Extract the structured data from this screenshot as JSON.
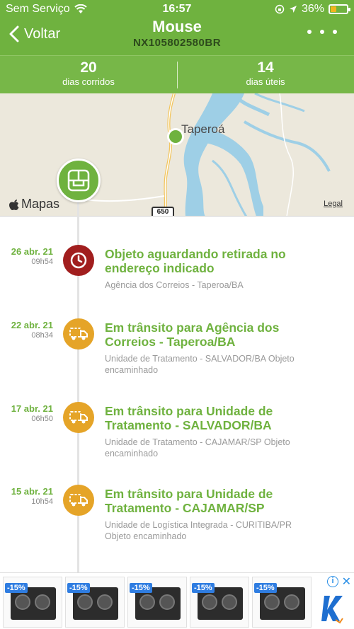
{
  "status_bar": {
    "carrier": "Sem Serviço",
    "time": "16:57",
    "battery": "36%",
    "battery_level": 0.36
  },
  "header": {
    "back_label": "Voltar",
    "title": "Mouse",
    "tracking_code": "NX105802580BR"
  },
  "days": {
    "calendar_count": "20",
    "calendar_label": "dias corridos",
    "business_count": "14",
    "business_label": "dias úteis"
  },
  "map": {
    "place_label": "Taperoá",
    "provider": "Mapas",
    "legal": "Legal",
    "road_number": "650"
  },
  "events": [
    {
      "date": "26 abr. 21",
      "time": "09h54",
      "title": "Objeto aguardando retirada no endereço indicado",
      "description": "Agência dos Correios - Taperoa/BA",
      "icon": "clock-icon",
      "color": "#a11e1e"
    },
    {
      "date": "22 abr. 21",
      "time": "08h34",
      "title": "Em trânsito para Agência dos Correios - Taperoa/BA",
      "description": "Unidade de Tratamento - SALVADOR/BA Objeto encaminhado",
      "icon": "truck-icon",
      "color": "#e5a428"
    },
    {
      "date": "17 abr. 21",
      "time": "06h50",
      "title": "Em trânsito para Unidade de Tratamento - SALVADOR/BA",
      "description": "Unidade de Tratamento - CAJAMAR/SP Objeto encaminhado",
      "icon": "truck-icon",
      "color": "#e5a428"
    },
    {
      "date": "15 abr. 21",
      "time": "10h54",
      "title": "Em trânsito para Unidade de Tratamento - CAJAMAR/SP",
      "description": "Unidade de Logística Integrada - CURITIBA/PR Objeto encaminhado",
      "icon": "truck-icon",
      "color": "#e5a428"
    }
  ],
  "ad": {
    "items": [
      {
        "discount": "-15%"
      },
      {
        "discount": "-15%"
      },
      {
        "discount": "-15%"
      },
      {
        "discount": "-15%"
      },
      {
        "discount": "-15%"
      }
    ],
    "info": "i",
    "close": "✕"
  },
  "colors": {
    "brand_green": "#6fb23f",
    "alert_red": "#a11e1e",
    "transit_orange": "#e5a428"
  }
}
